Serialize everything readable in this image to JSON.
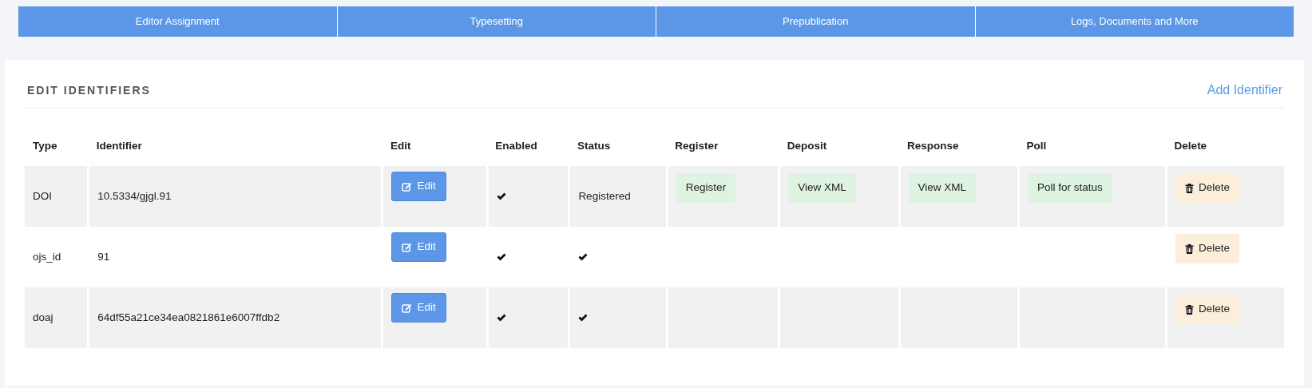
{
  "tabs": [
    {
      "label": "Editor Assignment"
    },
    {
      "label": "Typesetting"
    },
    {
      "label": "Prepublication"
    },
    {
      "label": "Logs, Documents and More"
    }
  ],
  "section": {
    "title": "EDIT IDENTIFIERS",
    "action": "Add Identifier"
  },
  "table": {
    "columns": [
      "Type",
      "Identifier",
      "Edit",
      "Enabled",
      "Status",
      "Register",
      "Deposit",
      "Response",
      "Poll",
      "Delete"
    ],
    "rows": [
      {
        "type": "DOI",
        "identifier": "10.5334/gjgl.91",
        "edit": "Edit",
        "enabled": true,
        "status": {
          "kind": "text",
          "text": "Registered"
        },
        "register": "Register",
        "deposit": "View XML",
        "response": "View XML",
        "poll": "Poll for status",
        "delete": "Delete"
      },
      {
        "type": "ojs_id",
        "identifier": "91",
        "edit": "Edit",
        "enabled": true,
        "status": {
          "kind": "check"
        },
        "delete": "Delete"
      },
      {
        "type": "doaj",
        "identifier": "64df55a21ce34ea0821861e6007ffdb2",
        "edit": "Edit",
        "enabled": true,
        "status": {
          "kind": "check"
        },
        "delete": "Delete"
      }
    ]
  }
}
